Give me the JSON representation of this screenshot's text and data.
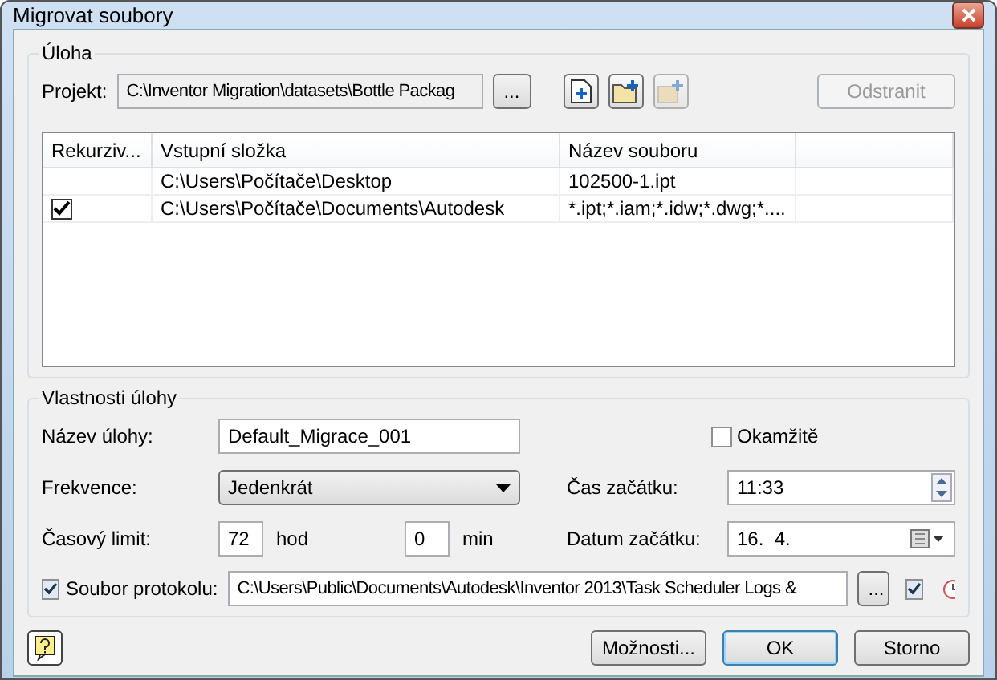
{
  "window": {
    "title": "Migrovat soubory"
  },
  "task": {
    "legend": "Úloha",
    "project_label": "Projekt:",
    "project_value": "C:\\Inventor Migration\\datasets\\Bottle Packag",
    "browse": "...",
    "remove": {
      "label": "Odstranit",
      "disabled": true
    },
    "table": {
      "columns": [
        "Rekurziv...",
        "Vstupní složka",
        "Název souboru"
      ],
      "rows": [
        {
          "recursive": false,
          "folder": "C:\\Users\\Počítače\\Desktop",
          "file": "102500-1.ipt"
        },
        {
          "recursive": true,
          "folder": "C:\\Users\\Počítače\\Documents\\Autodesk",
          "file": "*.ipt;*.iam;*.idw;*.dwg;*...."
        }
      ]
    }
  },
  "properties": {
    "legend": "Vlastnosti úlohy",
    "name_label": "Název úlohy:",
    "name_value": "Default_Migrace_001",
    "immediate": {
      "label": "Okamžitě",
      "checked": false
    },
    "frequency_label": "Frekvence:",
    "frequency_value": "Jedenkrát",
    "start_time_label": "Čas začátku:",
    "start_time_value": "11:33",
    "timeout_label": "Časový limit:",
    "hours_value": "72",
    "hours_unit": "hod",
    "minutes_value": "0",
    "minutes_unit": "min",
    "start_date_label": "Datum začátku:",
    "start_date_value": "16.  4.",
    "log": {
      "label": "Soubor protokolu:",
      "checked": true,
      "value": "C:\\Users\\Public\\Documents\\Autodesk\\Inventor 2013\\Task Scheduler Logs &",
      "browse": "...",
      "option_checked": true
    }
  },
  "buttons": [
    {
      "label": "Možnosti...",
      "default": false
    },
    {
      "label": "OK",
      "default": true
    },
    {
      "label": "Storno",
      "default": false
    }
  ]
}
